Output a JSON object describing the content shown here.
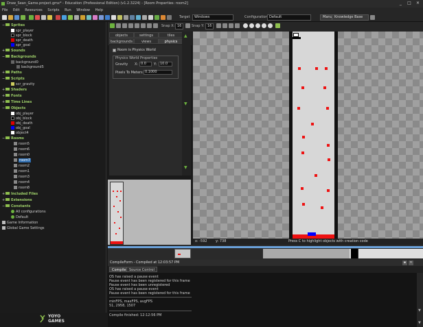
{
  "window": {
    "title": "Draw_Sean_Game.project.gmx* - Education (Professional Edition) (v1.2.3224) - [Room Properties: room2]",
    "controls": [
      "_",
      "□",
      "✕"
    ]
  },
  "menu": [
    "File",
    "Edit",
    "Resources",
    "Scripts",
    "Run",
    "Window",
    "Help"
  ],
  "toolbar": {
    "target_label": "Target",
    "target_value": "Windows",
    "config_label": "Configuration",
    "config_value": "Default",
    "manual_label": "Manual",
    "knowledge_label": "Knowledge Base"
  },
  "tree": {
    "sprites": {
      "label": "Sprites",
      "items": [
        "spr_player",
        "spr_block",
        "spr_death",
        "spr_goal"
      ]
    },
    "sounds": "Sounds",
    "backgrounds": {
      "label": "Backgrounds",
      "items": [
        "background0",
        "background5"
      ]
    },
    "paths": "Paths",
    "scripts": {
      "label": "Scripts",
      "items": [
        "scr_gravity"
      ]
    },
    "shaders": "Shaders",
    "fonts": "Fonts",
    "timelines": "Time Lines",
    "objects": {
      "label": "Objects",
      "items": [
        "obj_player",
        "obj_block",
        "obj_death",
        "obj_goal",
        "object4"
      ]
    },
    "rooms": {
      "label": "Rooms",
      "items": [
        "room5",
        "room6",
        "room0",
        "room7",
        "room2",
        "room1",
        "room3",
        "room4",
        "room8"
      ],
      "selected": "room7"
    },
    "included": "Included Files",
    "extensions": "Extensions",
    "constants": {
      "label": "Constants",
      "items": [
        "All configurations",
        "Default"
      ]
    },
    "game_info": "Game Information",
    "global_settings": "Global Game Settings"
  },
  "logo": {
    "text1": "YOYO",
    "text2": "GAMES"
  },
  "room_toolbar": {
    "snapx_label": "Snap X:",
    "snapx_value": "16",
    "snapy_label": "Snap Y:",
    "snapy_value": "16"
  },
  "room_tabs": [
    "objects",
    "settings",
    "tiles",
    "backgrounds",
    "views",
    "physics"
  ],
  "physics": {
    "checkbox_label": "Room is Physics World",
    "group_label": "Physics World Properties",
    "gravity_label": "Gravity",
    "x_label": "X:",
    "x_value": "0.0",
    "y_label": "Y:",
    "y_value": "10.0",
    "pixels_label": "Pixels To Meters",
    "pixels_value": "0.1000"
  },
  "status": {
    "x": "x: -592",
    "y": "y: 738",
    "hint": "Press C to highlight objects with creation code"
  },
  "compile": {
    "title": "CompileForm - Compiled at 12:03:57 PM",
    "tabs": [
      "Compile",
      "Source Control"
    ],
    "lines": [
      "OS has raised a pause event",
      "Pause event has been registered for this frame",
      "Pause event has been unregistered",
      "OS has raised a pause event",
      "Pause event has been registered for this frame",
      "",
      "minFPS, maxFPS, avgFPS",
      "51, 2958, 1507",
      "",
      "Compile finished: 12:12:56 PM"
    ]
  },
  "colors": {
    "spr_player": "#ffffff",
    "spr_block": "#000000",
    "spr_death": "#e00000",
    "spr_goal": "#0000ff",
    "obj_player": "#ffffff",
    "obj_block": "#000000",
    "obj_death": "#e00000",
    "obj_goal": "#0000ff",
    "object4": "#ffffff",
    "accent": "#8fc04e"
  }
}
